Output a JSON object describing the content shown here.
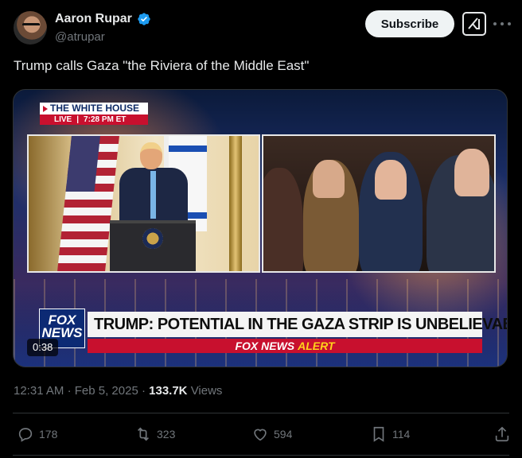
{
  "author": {
    "display_name": "Aaron Rupar",
    "handle": "@atrupar",
    "verified": true
  },
  "header": {
    "subscribe_label": "Subscribe",
    "grok_icon": "grok-icon",
    "more_icon": "more-icon"
  },
  "tweet": {
    "text": "Trump calls Gaza \"the Riviera of the Middle East\""
  },
  "media": {
    "bug_title": "THE WHITE HOUSE",
    "bug_live": "LIVE",
    "bug_time": "7:28 PM ET",
    "logo_text_1": "FOX",
    "logo_text_2": "NEWS",
    "headline": "TRUMP: POTENTIAL IN THE GAZA STRIP IS UNBELIEVABLE",
    "alert_brand": "FOX NEWS",
    "alert_word": "ALERT",
    "duration": "0:38"
  },
  "meta": {
    "time": "12:31 AM",
    "separator": "·",
    "date": "Feb 5, 2025",
    "views_count": "133.7K",
    "views_label": "Views"
  },
  "actions": {
    "replies": "178",
    "reposts": "323",
    "likes": "594",
    "bookmarks": "114"
  },
  "colors": {
    "background": "#000000",
    "text_primary": "#e7e9ea",
    "text_secondary": "#71767b",
    "verified_blue": "#1d9bf0",
    "fox_red": "#c8102e"
  }
}
